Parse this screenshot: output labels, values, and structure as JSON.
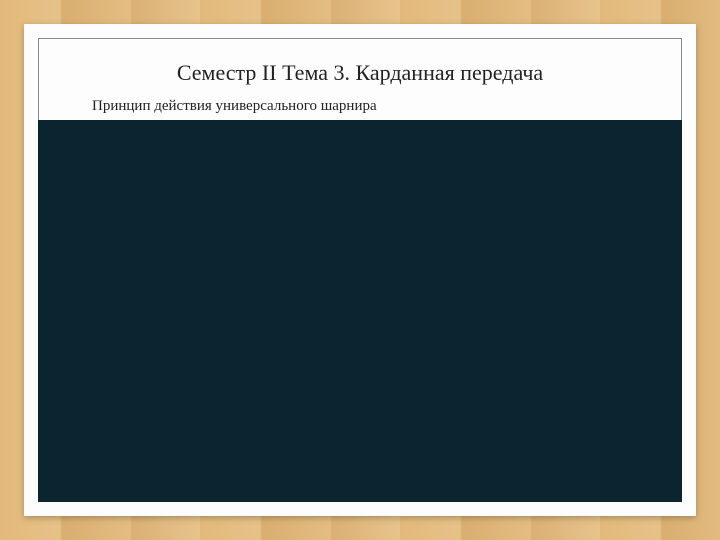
{
  "slide": {
    "title": "Семестр II Тема 3. Карданная передача",
    "subtitle": "Принцип действия универсального шарнира"
  }
}
